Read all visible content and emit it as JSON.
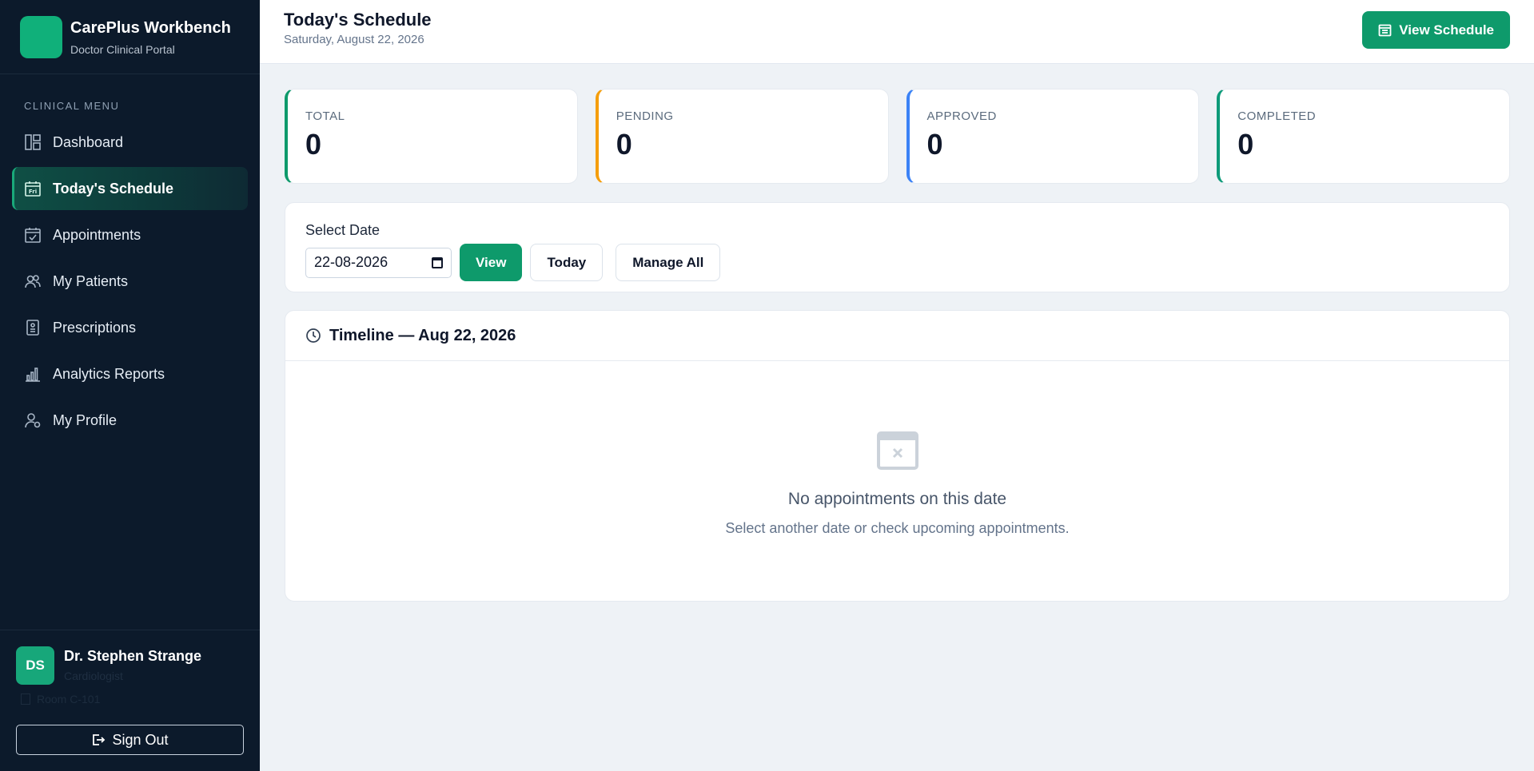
{
  "sidebar": {
    "brand_title": "CarePlus Workbench",
    "brand_subtitle": "Doctor Clinical Portal",
    "menu_heading": "CLINICAL MENU",
    "items": [
      {
        "label": "Dashboard",
        "icon": "dashboard-icon",
        "active": false
      },
      {
        "label": "Today's Schedule",
        "icon": "calendar-day-icon",
        "active": true
      },
      {
        "label": "Appointments",
        "icon": "calendar-check-icon",
        "active": false
      },
      {
        "label": "My Patients",
        "icon": "users-icon",
        "active": false
      },
      {
        "label": "Prescriptions",
        "icon": "prescription-icon",
        "active": false
      },
      {
        "label": "Analytics Reports",
        "icon": "bar-chart-icon",
        "active": false
      },
      {
        "label": "My Profile",
        "icon": "user-gear-icon",
        "active": false
      }
    ],
    "user": {
      "initials": "DS",
      "name": "Dr. Stephen Strange",
      "role": "Cardiologist",
      "room": "Room C-101"
    },
    "signout_label": "Sign Out",
    "calendar_icon_day": "Fri"
  },
  "header": {
    "title": "Today's Schedule",
    "date": "Saturday, August 22, 2026",
    "button_label": "View Schedule"
  },
  "stats": [
    {
      "label": "TOTAL",
      "value": "0",
      "color": "#0e9a6b"
    },
    {
      "label": "PENDING",
      "value": "0",
      "color": "#f59e0b"
    },
    {
      "label": "APPROVED",
      "value": "0",
      "color": "#3b82f6"
    },
    {
      "label": "COMPLETED",
      "value": "0",
      "color": "#0e9b7a"
    }
  ],
  "filter": {
    "label": "Select Date",
    "date_value": "22-08-2026",
    "view_label": "View",
    "today_label": "Today",
    "manage_label": "Manage All"
  },
  "timeline": {
    "title": "Timeline — Aug 22, 2026",
    "empty_title": "No appointments on this date",
    "empty_subtitle": "Select another date or check upcoming appointments."
  },
  "colors": {
    "accent": "#0e9a6b",
    "sidebar_bg": "#0c1a2b",
    "page_bg": "#eef2f6"
  }
}
